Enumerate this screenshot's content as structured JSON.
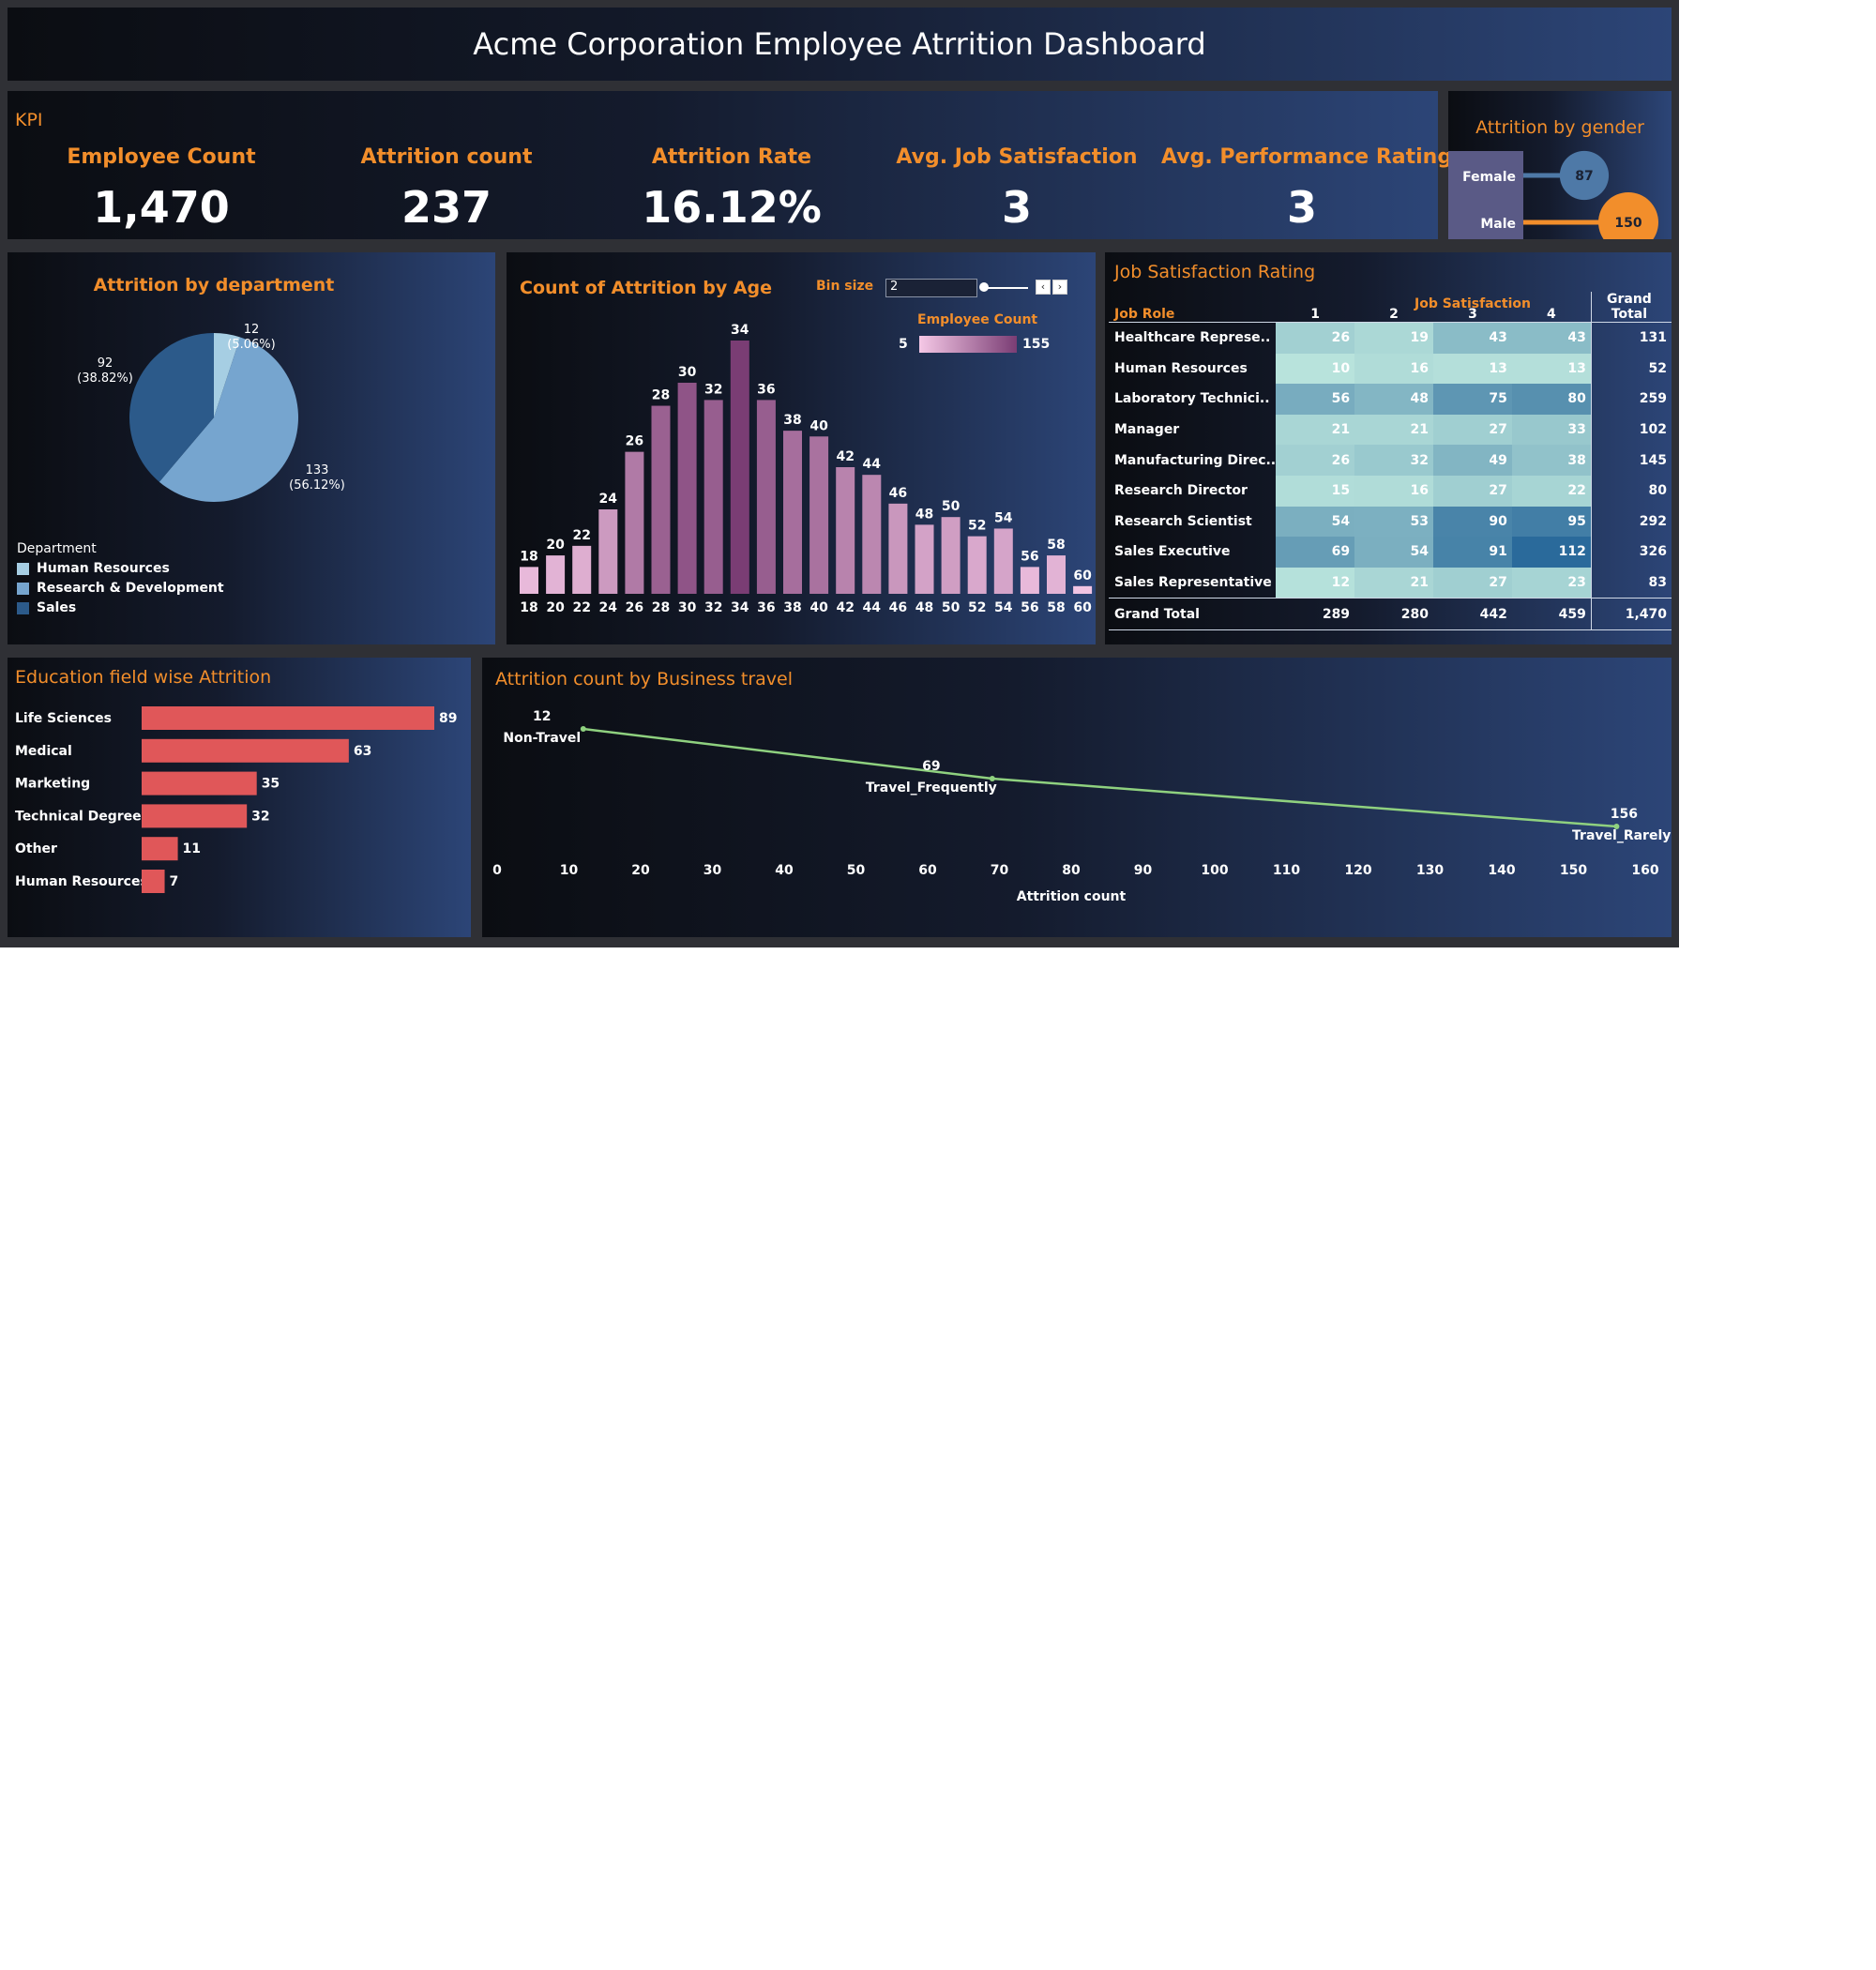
{
  "header": {
    "title": "Acme Corporation  Employee Atrrition Dashboard"
  },
  "kpi": {
    "title": "KPI",
    "cards": [
      {
        "label": "Employee Count",
        "value": "1,470"
      },
      {
        "label": "Attrition count",
        "value": "237"
      },
      {
        "label": "Attrition Rate",
        "value": "16.12%"
      },
      {
        "label": "Avg. Job Satisfaction",
        "value": "3"
      },
      {
        "label": "Avg. Performance Rating",
        "value": "3"
      }
    ]
  },
  "colors": {
    "accent": "#f28e2b",
    "female": "#4e79a7",
    "male": "#f28e2b",
    "dept_hr": "#a6cee3",
    "dept_rd": "#76a5cf",
    "dept_sales": "#2c5a8a",
    "age_low": "#f5c8e6",
    "age_high": "#7a3d74",
    "edu_bar": "#e05759",
    "travel_line": "#8fd17f",
    "heat_low": "#b8e3dc",
    "heat_high": "#2a6a9b"
  },
  "age_controls": {
    "bin_label": "Bin size",
    "bin_value": "2",
    "legend_title": "Employee Count",
    "legend_min": "5",
    "legend_max": "155"
  },
  "job_satisfaction": {
    "header_group": "Job Satisfaction",
    "row_header": "Job Role",
    "columns": [
      "1",
      "2",
      "3",
      "4"
    ],
    "total_header": "Grand Total",
    "rows": [
      {
        "role": "Healthcare Represe..",
        "values": [
          26,
          19,
          43,
          43
        ],
        "total": "131"
      },
      {
        "role": "Human Resources",
        "values": [
          10,
          16,
          13,
          13
        ],
        "total": "52"
      },
      {
        "role": "Laboratory Technici..",
        "values": [
          56,
          48,
          75,
          80
        ],
        "total": "259"
      },
      {
        "role": "Manager",
        "values": [
          21,
          21,
          27,
          33
        ],
        "total": "102"
      },
      {
        "role": "Manufacturing Direc..",
        "values": [
          26,
          32,
          49,
          38
        ],
        "total": "145"
      },
      {
        "role": "Research Director",
        "values": [
          15,
          16,
          27,
          22
        ],
        "total": "80"
      },
      {
        "role": "Research Scientist",
        "values": [
          54,
          53,
          90,
          95
        ],
        "total": "292"
      },
      {
        "role": "Sales Executive",
        "values": [
          69,
          54,
          91,
          112
        ],
        "total": "326"
      },
      {
        "role": "Sales Representative",
        "values": [
          12,
          21,
          27,
          23
        ],
        "total": "83"
      }
    ],
    "grand_total": {
      "role": "Grand Total",
      "values": [
        "289",
        "280",
        "442",
        "459"
      ],
      "total": "1,470"
    }
  },
  "chart_data": [
    {
      "type": "scatter",
      "title": "Attrition by gender",
      "categories": [
        "Female",
        "Male"
      ],
      "values": [
        87,
        150
      ],
      "value_labels": [
        "87",
        "150"
      ]
    },
    {
      "type": "pie",
      "title": "Attrition by department",
      "legend_title": "Department",
      "categories": [
        "Human Resources",
        "Research & Development",
        "Sales"
      ],
      "values": [
        12,
        133,
        92
      ],
      "value_labels": [
        "12",
        "133",
        "92"
      ],
      "percent_labels": [
        "(5.06%)",
        "(56.12%)",
        "(38.82%)"
      ]
    },
    {
      "type": "bar",
      "title": "Count of Attrition by Age",
      "categories": [
        "18",
        "20",
        "22",
        "24",
        "26",
        "28",
        "30",
        "32",
        "34",
        "36",
        "38",
        "40",
        "42",
        "44",
        "46",
        "48",
        "50",
        "52",
        "54",
        "56",
        "58",
        "60"
      ],
      "values": [
        18,
        20,
        22,
        24,
        26,
        28,
        30,
        32,
        34,
        36,
        38,
        40,
        42,
        44,
        46,
        48,
        50,
        52,
        54,
        56,
        58,
        60
      ],
      "value_labels": [
        "18",
        "20",
        "22",
        "24",
        "26",
        "28",
        "30",
        "32",
        "34",
        "36",
        "38",
        "40",
        "42",
        "44",
        "46",
        "48",
        "50",
        "52",
        "54",
        "56",
        "58",
        "60"
      ],
      "heights": [
        14,
        20,
        25,
        44,
        74,
        98,
        110,
        101,
        132,
        101,
        85,
        82,
        66,
        62,
        47,
        36,
        40,
        30,
        34,
        14,
        20,
        4
      ]
    },
    {
      "type": "bar",
      "title": "Education field wise Attrition",
      "orientation": "horizontal",
      "categories": [
        "Life Sciences",
        "Medical",
        "Marketing",
        "Technical Degree",
        "Other",
        "Human Resources"
      ],
      "values": [
        89,
        63,
        35,
        32,
        11,
        7
      ],
      "value_labels": [
        "89",
        "63",
        "35",
        "32",
        "11",
        "7"
      ]
    },
    {
      "type": "line",
      "title": "Attrition count by Business travel",
      "xlabel": "Attrition count",
      "xlim": [
        0,
        160
      ],
      "x_ticks": [
        "0",
        "10",
        "20",
        "30",
        "40",
        "50",
        "60",
        "70",
        "80",
        "90",
        "100",
        "110",
        "120",
        "130",
        "140",
        "150",
        "160"
      ],
      "points": [
        {
          "category": "Non-Travel",
          "x": 12,
          "label": "12"
        },
        {
          "category": "Travel_Frequently",
          "x": 69,
          "label": "69"
        },
        {
          "category": "Travel_Rarely",
          "x": 156,
          "label": "156"
        }
      ]
    }
  ]
}
